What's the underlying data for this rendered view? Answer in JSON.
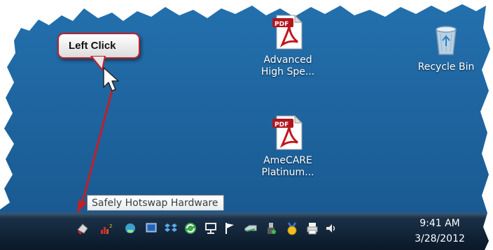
{
  "callout": {
    "label": "Left Click"
  },
  "desktop_icons": [
    {
      "label_line1": "Advanced",
      "label_line2": "High Spe...",
      "icon": "pdf-file-icon",
      "badge": "PDF"
    },
    {
      "label_line1": "AmeCARE",
      "label_line2": "Platinum...",
      "icon": "pdf-file-icon",
      "badge": "PDF"
    },
    {
      "label_line1": "Recycle Bin",
      "icon": "recycle-bin-icon"
    }
  ],
  "tooltip": {
    "text": "Safely Hotswap Hardware"
  },
  "taskbar": {
    "clock": {
      "time": "9:41 AM",
      "date": "3/28/2012"
    },
    "tray_icons": [
      "safely-hotswap-hardware-icon",
      "resource-meter-icon",
      "network-drive-icon",
      "display-icon",
      "dropbox-icon",
      "sync-icon",
      "network-icon",
      "action-center-flag-icon",
      "drive-icon",
      "usb-device-icon",
      "award-icon",
      "printer-icon",
      "volume-icon"
    ]
  },
  "colors": {
    "desktop": "#1f5f98",
    "taskbar": "#0d2237",
    "arrow": "#c0202a"
  }
}
